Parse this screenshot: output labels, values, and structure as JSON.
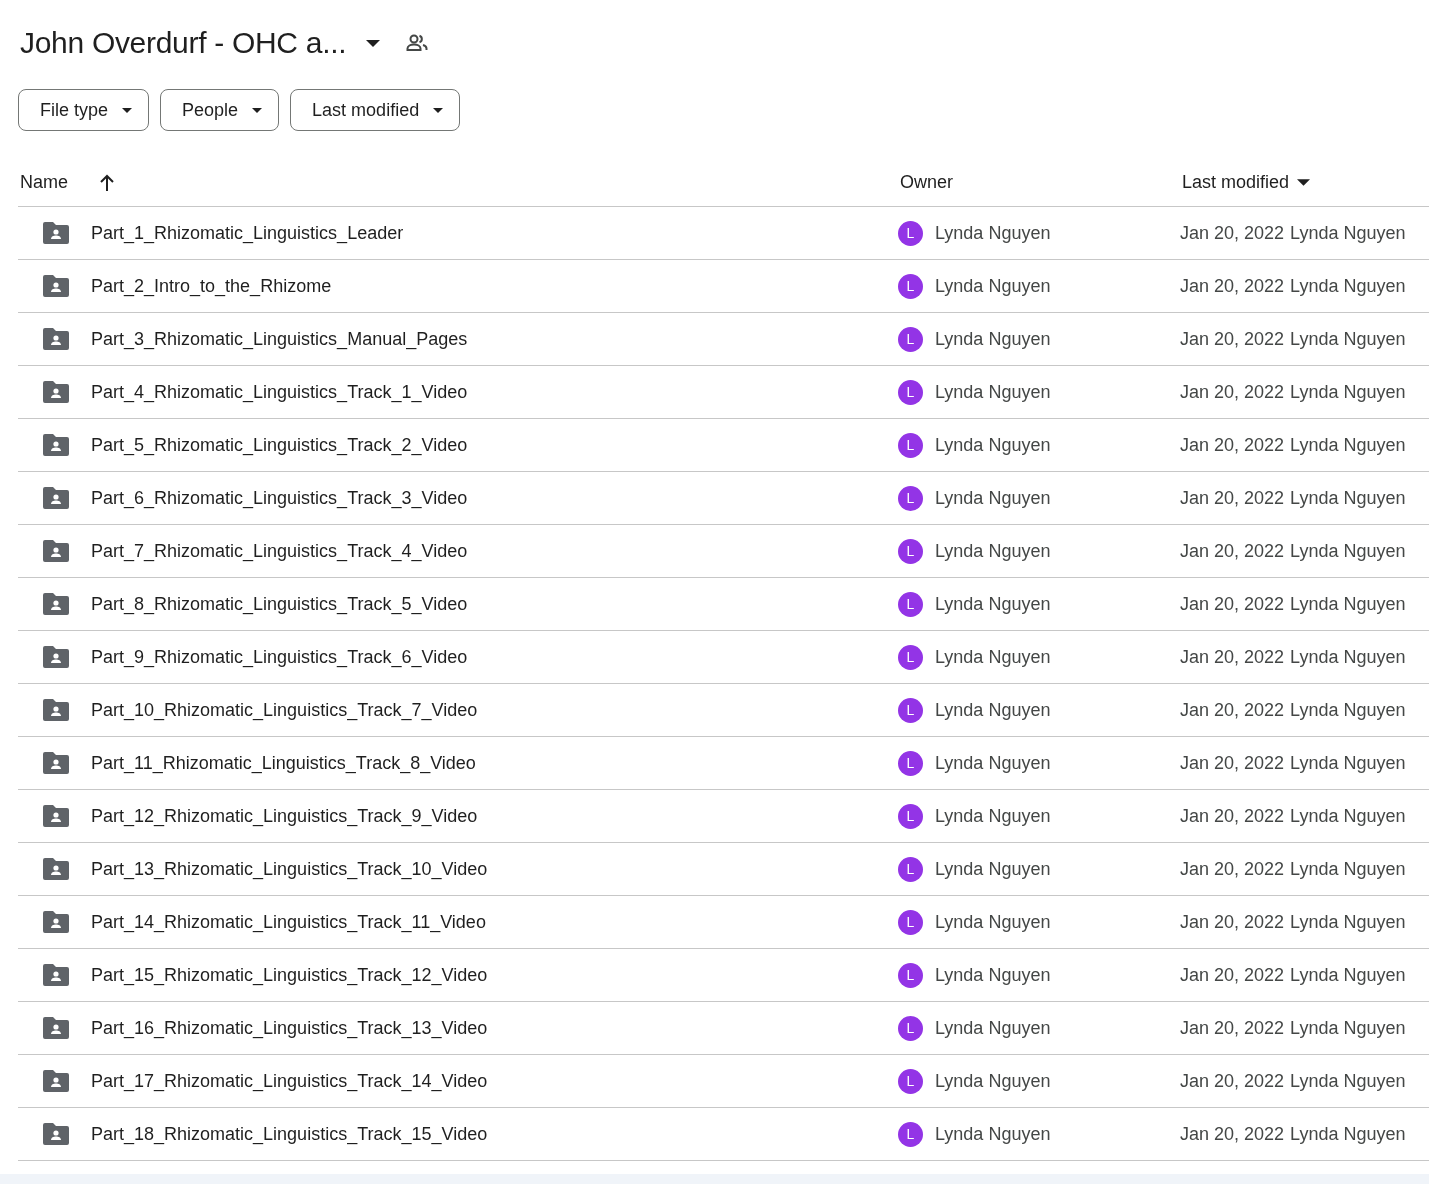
{
  "title": "John Overdurf - OHC a...",
  "filters": [
    "File type",
    "People",
    "Last modified"
  ],
  "columns": [
    {
      "label": "Name",
      "sorted_ascending": true,
      "has_menu": false
    },
    {
      "label": "Owner",
      "sorted_ascending": false,
      "has_menu": false
    },
    {
      "label": "Last modified",
      "sorted_ascending": false,
      "has_menu": true
    }
  ],
  "rows": [
    {
      "name": "Part_1_Rhizomatic_Linguistics_Leader",
      "owner_initial": "L",
      "owner": "Lynda Nguyen",
      "modified": "Jan 20, 2022",
      "modified_by": "Lynda Nguyen"
    },
    {
      "name": "Part_2_Intro_to_the_Rhizome",
      "owner_initial": "L",
      "owner": "Lynda Nguyen",
      "modified": "Jan 20, 2022",
      "modified_by": "Lynda Nguyen"
    },
    {
      "name": "Part_3_Rhizomatic_Linguistics_Manual_Pages",
      "owner_initial": "L",
      "owner": "Lynda Nguyen",
      "modified": "Jan 20, 2022",
      "modified_by": "Lynda Nguyen"
    },
    {
      "name": "Part_4_Rhizomatic_Linguistics_Track_1_Video",
      "owner_initial": "L",
      "owner": "Lynda Nguyen",
      "modified": "Jan 20, 2022",
      "modified_by": "Lynda Nguyen"
    },
    {
      "name": "Part_5_Rhizomatic_Linguistics_Track_2_Video",
      "owner_initial": "L",
      "owner": "Lynda Nguyen",
      "modified": "Jan 20, 2022",
      "modified_by": "Lynda Nguyen"
    },
    {
      "name": "Part_6_Rhizomatic_Linguistics_Track_3_Video",
      "owner_initial": "L",
      "owner": "Lynda Nguyen",
      "modified": "Jan 20, 2022",
      "modified_by": "Lynda Nguyen"
    },
    {
      "name": "Part_7_Rhizomatic_Linguistics_Track_4_Video",
      "owner_initial": "L",
      "owner": "Lynda Nguyen",
      "modified": "Jan 20, 2022",
      "modified_by": "Lynda Nguyen"
    },
    {
      "name": "Part_8_Rhizomatic_Linguistics_Track_5_Video",
      "owner_initial": "L",
      "owner": "Lynda Nguyen",
      "modified": "Jan 20, 2022",
      "modified_by": "Lynda Nguyen"
    },
    {
      "name": "Part_9_Rhizomatic_Linguistics_Track_6_Video",
      "owner_initial": "L",
      "owner": "Lynda Nguyen",
      "modified": "Jan 20, 2022",
      "modified_by": "Lynda Nguyen"
    },
    {
      "name": "Part_10_Rhizomatic_Linguistics_Track_7_Video",
      "owner_initial": "L",
      "owner": "Lynda Nguyen",
      "modified": "Jan 20, 2022",
      "modified_by": "Lynda Nguyen"
    },
    {
      "name": "Part_11_Rhizomatic_Linguistics_Track_8_Video",
      "owner_initial": "L",
      "owner": "Lynda Nguyen",
      "modified": "Jan 20, 2022",
      "modified_by": "Lynda Nguyen"
    },
    {
      "name": "Part_12_Rhizomatic_Linguistics_Track_9_Video",
      "owner_initial": "L",
      "owner": "Lynda Nguyen",
      "modified": "Jan 20, 2022",
      "modified_by": "Lynda Nguyen"
    },
    {
      "name": "Part_13_Rhizomatic_Linguistics_Track_10_Video",
      "owner_initial": "L",
      "owner": "Lynda Nguyen",
      "modified": "Jan 20, 2022",
      "modified_by": "Lynda Nguyen"
    },
    {
      "name": "Part_14_Rhizomatic_Linguistics_Track_11_Video",
      "owner_initial": "L",
      "owner": "Lynda Nguyen",
      "modified": "Jan 20, 2022",
      "modified_by": "Lynda Nguyen"
    },
    {
      "name": "Part_15_Rhizomatic_Linguistics_Track_12_Video",
      "owner_initial": "L",
      "owner": "Lynda Nguyen",
      "modified": "Jan 20, 2022",
      "modified_by": "Lynda Nguyen"
    },
    {
      "name": "Part_16_Rhizomatic_Linguistics_Track_13_Video",
      "owner_initial": "L",
      "owner": "Lynda Nguyen",
      "modified": "Jan 20, 2022",
      "modified_by": "Lynda Nguyen"
    },
    {
      "name": "Part_17_Rhizomatic_Linguistics_Track_14_Video",
      "owner_initial": "L",
      "owner": "Lynda Nguyen",
      "modified": "Jan 20, 2022",
      "modified_by": "Lynda Nguyen"
    },
    {
      "name": "Part_18_Rhizomatic_Linguistics_Track_15_Video",
      "owner_initial": "L",
      "owner": "Lynda Nguyen",
      "modified": "Jan 20, 2022",
      "modified_by": "Lynda Nguyen"
    }
  ]
}
